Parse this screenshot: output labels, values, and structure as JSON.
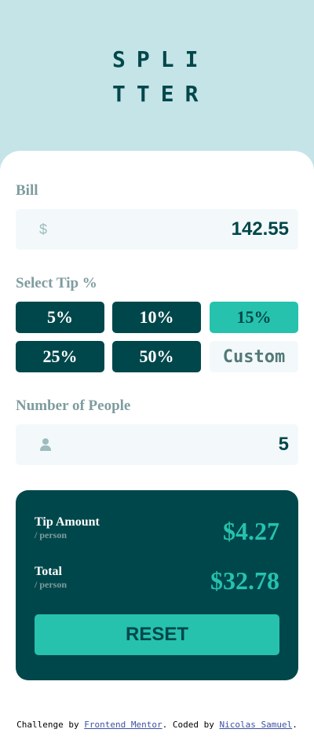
{
  "logo": {
    "text": "SPLITTER"
  },
  "bill": {
    "label": "Bill",
    "currency_symbol": "$",
    "value": "142.55",
    "icon": "dollar-icon"
  },
  "tip": {
    "label": "Select Tip %",
    "options": [
      "5%",
      "10%",
      "15%",
      "25%",
      "50%"
    ],
    "selected": "15%",
    "custom_placeholder": "Custom"
  },
  "people": {
    "label": "Number of People",
    "value": "5",
    "icon": "person-icon"
  },
  "results": {
    "tip_label": "Tip Amount",
    "tip_sub": "/ person",
    "tip_value": "$4.27",
    "total_label": "Total",
    "total_sub": "/ person",
    "total_value": "$32.78",
    "reset_label": "RESET"
  },
  "attribution": {
    "prefix": "Challenge by ",
    "link1": "Frontend Mentor",
    "middle": ". Coded by ",
    "link2": "Nicolas Samuel",
    "suffix": "."
  },
  "colors": {
    "background": "#c5e4e7",
    "dark_cyan": "#00474b",
    "strong_cyan": "#26c2ad",
    "light_grayish_cyan": "#f3f9fa",
    "grayish_cyan": "#7f9c9f"
  }
}
